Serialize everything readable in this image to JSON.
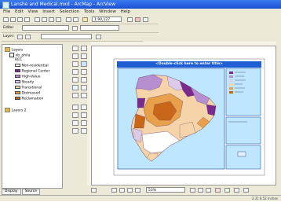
{
  "window": {
    "title": "Lanshe and Medical.mxd - ArcMap - ArcView"
  },
  "menu": [
    "File",
    "Edit",
    "View",
    "Insert",
    "Selection",
    "Tools",
    "Window",
    "Help"
  ],
  "toolbar": {
    "scale": "1:90,127",
    "editor_label": "Editor",
    "layer_label": "Layer:"
  },
  "toc": {
    "layers_label": "Layers",
    "group_label": "nb_phila",
    "field_label": "REC",
    "legend": [
      {
        "label": "Non-residential",
        "color": "#ffffff"
      },
      {
        "label": "Regional Center",
        "color": "#7a2a8a"
      },
      {
        "label": "High-Value",
        "color": "#b58fd0"
      },
      {
        "label": "Steady",
        "color": "#dccbe8"
      },
      {
        "label": "Transitional",
        "color": "#f4d4a8"
      },
      {
        "label": "Distressed",
        "color": "#e9a04a"
      },
      {
        "label": "Reclamation",
        "color": "#c8661a"
      }
    ],
    "layer2_label": "Layers 2",
    "tabs": [
      "Display",
      "Source"
    ]
  },
  "layout": {
    "map_title": "<Double-click here to enter title>",
    "zoom": "53%"
  },
  "status": "3.31 8.52 Inches",
  "colors": {
    "title_bar": "#1e5fd6",
    "panel_bg": "#bfe6ff",
    "map_border": "#2a5aa8"
  }
}
